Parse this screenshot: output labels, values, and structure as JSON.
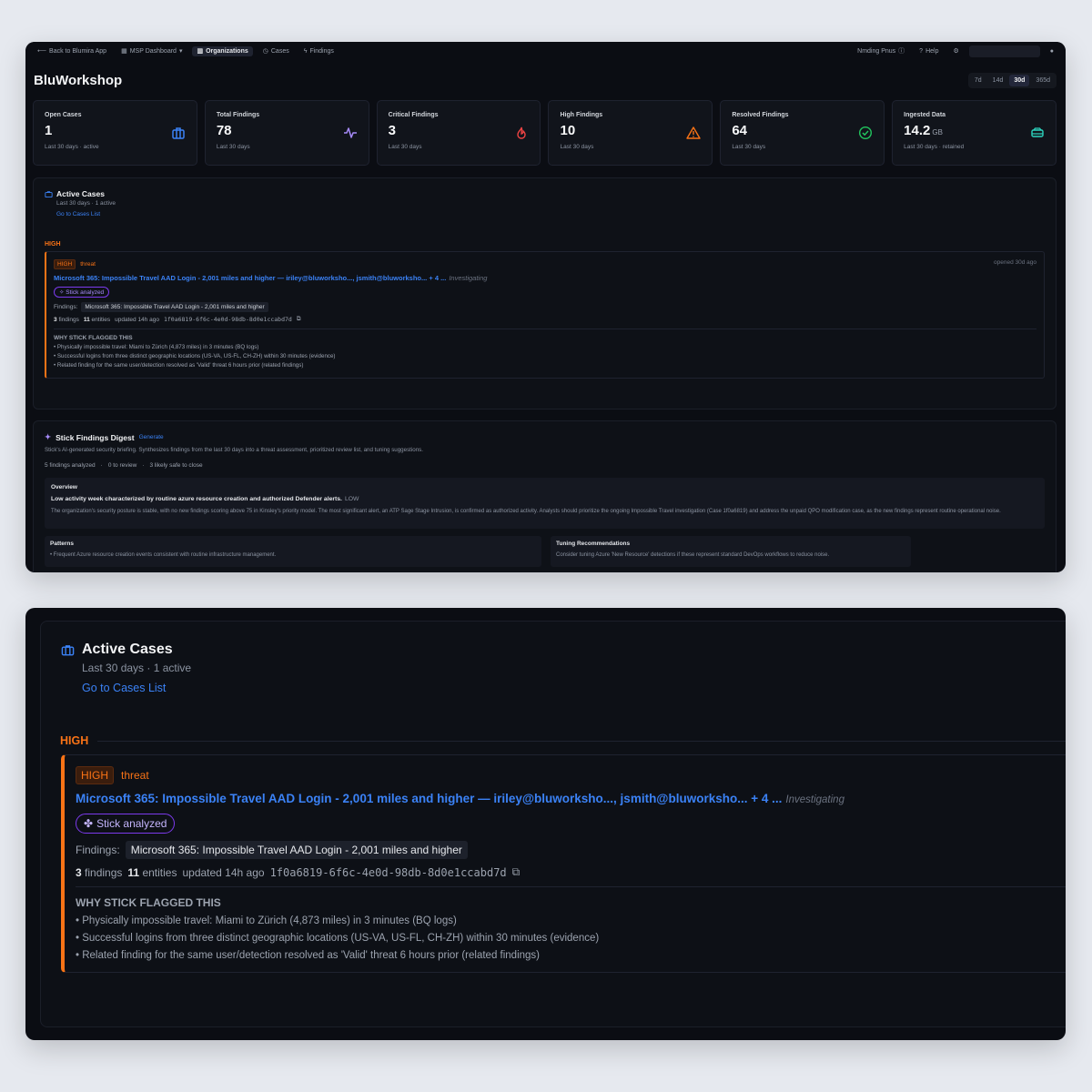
{
  "nav": {
    "back": "Back to Blumira App",
    "msp": "MSP Dashboard",
    "orgs": "Organizations",
    "cases": "Cases",
    "findings": "Findings",
    "right_label": "Nmding Pnus",
    "help": "Help"
  },
  "page": {
    "title": "BluWorkshop"
  },
  "ranges": [
    "7d",
    "14d",
    "30d",
    "365d"
  ],
  "active_range": "30d",
  "stats": [
    {
      "label": "Open Cases",
      "value": "1",
      "unit": "",
      "sub": "Last 30 days · active",
      "icon": "briefcase-icon",
      "color": "#3b82f6"
    },
    {
      "label": "Total Findings",
      "value": "78",
      "unit": "",
      "sub": "Last 30 days",
      "icon": "activity-icon",
      "color": "#a78bfa"
    },
    {
      "label": "Critical Findings",
      "value": "3",
      "unit": "",
      "sub": "Last 30 days",
      "icon": "flame-icon",
      "color": "#ef4444"
    },
    {
      "label": "High Findings",
      "value": "10",
      "unit": "",
      "sub": "Last 30 days",
      "icon": "warning-icon",
      "color": "#f97316"
    },
    {
      "label": "Resolved Findings",
      "value": "64",
      "unit": "",
      "sub": "Last 30 days",
      "icon": "check-circle-icon",
      "color": "#22c55e"
    },
    {
      "label": "Ingested Data",
      "value": "14.2",
      "unit": "GB",
      "sub": "Last 30 days · retained",
      "icon": "database-icon",
      "color": "#2dd4bf"
    }
  ],
  "active_cases": {
    "title": "Active Cases",
    "subtitle": "Last 30 days · 1 active",
    "link": "Go to Cases List",
    "severity_group": "HIGH",
    "case": {
      "severity": "HIGH",
      "type": "threat",
      "opened": "opened 30d ago",
      "title": "Microsoft 365: Impossible Travel AAD Login - 2,001 miles and higher — iriley@bluworksho..., jsmith@bluworksho... + 4 ...",
      "status": "Investigating",
      "stick_chip": "Stick analyzed",
      "findings_label": "Findings:",
      "finding_tag": "Microsoft 365: Impossible Travel AAD Login - 2,001 miles and higher",
      "findings_count": "3",
      "findings_word": "findings",
      "entities_count": "11",
      "entities_word": "entities",
      "updated": "updated 14h ago",
      "case_id": "1f0a6819-6f6c-4e0d-98db-8d0e1ccabd7d",
      "why_title": "WHY STICK FLAGGED THIS",
      "reasons": [
        "• Physically impossible travel: Miami to Zürich (4,873 miles) in 3 minutes (BQ logs)",
        "• Successful logins from three distinct geographic locations (US-VA, US-FL, CH-ZH) within 30 minutes (evidence)",
        "• Related finding for the same user/detection resolved as 'Valid' threat 6 hours prior (related findings)"
      ]
    }
  },
  "digest": {
    "title": "Stick Findings Digest",
    "generate": "Generate",
    "description": "Stick's AI-generated security briefing. Synthesizes findings from the last 30 days into a threat assessment, prioritized review list, and tuning suggestions.",
    "analyzed": "5 findings analyzed",
    "to_review": "0 to review",
    "safe": "3 likely safe to close",
    "overview_label": "Overview",
    "headline": "Low activity week characterized by routine azure resource creation and authorized Defender alerts.",
    "level": "LOW",
    "body": "The organization's security posture is stable, with no new findings scoring above 75 in Kinsley's priority model. The most significant alert, an ATP Sage Stage Intrusion, is confirmed as authorized activity. Analysts should prioritize the ongoing Impossible Travel investigation (Case 1f0a6819) and address the unpaid QPO modification case, as the new findings represent routine operational noise.",
    "patterns_label": "Patterns",
    "patterns_text": "• Frequent Azure resource creation events consistent with routine infrastructure management.",
    "tuning_label": "Tuning Recommendations",
    "tuning_text": "Consider tuning Azure 'New Resource' detections if these represent standard DevOps workflows to reduce noise."
  }
}
